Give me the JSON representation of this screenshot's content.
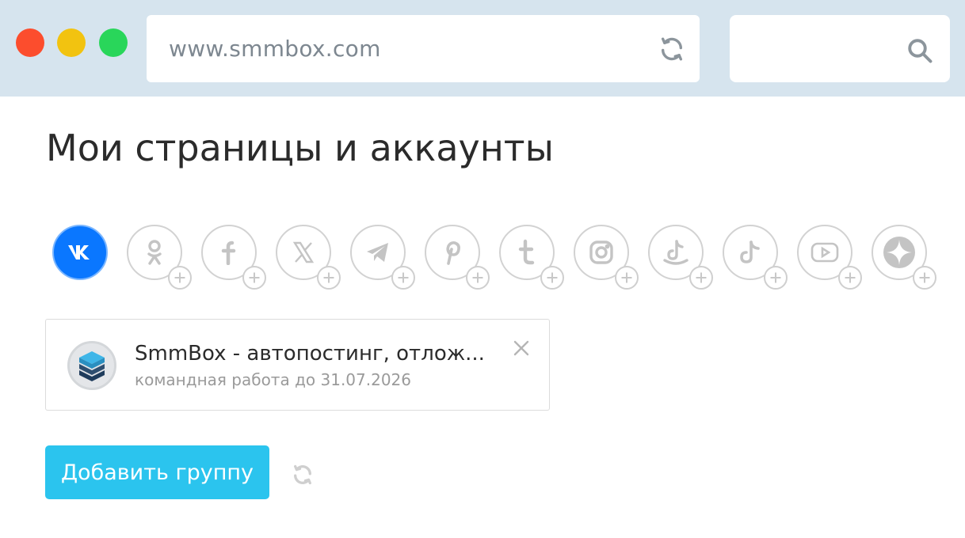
{
  "browser": {
    "url": "www.smmbox.com",
    "window_buttons": [
      "close",
      "minimize",
      "maximize"
    ],
    "reload_icon": "reload-icon",
    "search_icon": "search-icon"
  },
  "page": {
    "title": "Мои страницы и аккаунты"
  },
  "networks": [
    {
      "id": "vk",
      "icon": "vk-icon",
      "active": true
    },
    {
      "id": "ok",
      "icon": "odnoklassniki-icon",
      "active": false
    },
    {
      "id": "facebook",
      "icon": "facebook-icon",
      "active": false
    },
    {
      "id": "x",
      "icon": "x-icon",
      "active": false
    },
    {
      "id": "telegram",
      "icon": "telegram-icon",
      "active": false
    },
    {
      "id": "pinterest",
      "icon": "pinterest-icon",
      "active": false
    },
    {
      "id": "tumblr",
      "icon": "tumblr-icon",
      "active": false
    },
    {
      "id": "instagram",
      "icon": "instagram-icon",
      "active": false
    },
    {
      "id": "tiktok-1",
      "icon": "tiktok-icon",
      "active": false
    },
    {
      "id": "tiktok-2",
      "icon": "tiktok-icon",
      "active": false
    },
    {
      "id": "youtube",
      "icon": "youtube-icon",
      "active": false
    },
    {
      "id": "dzen",
      "icon": "dzen-icon",
      "active": false
    }
  ],
  "group": {
    "name": "SmmBox - автопостинг, отлож...",
    "subtitle": "командная работа до 31.07.2026"
  },
  "actions": {
    "add_group_label": "Добавить группу"
  },
  "colors": {
    "chrome_bg": "#d6e4ee",
    "vk_blue": "#0a77ff",
    "button_blue": "#2bc4ee",
    "icon_grey": "#cfcfcf"
  }
}
